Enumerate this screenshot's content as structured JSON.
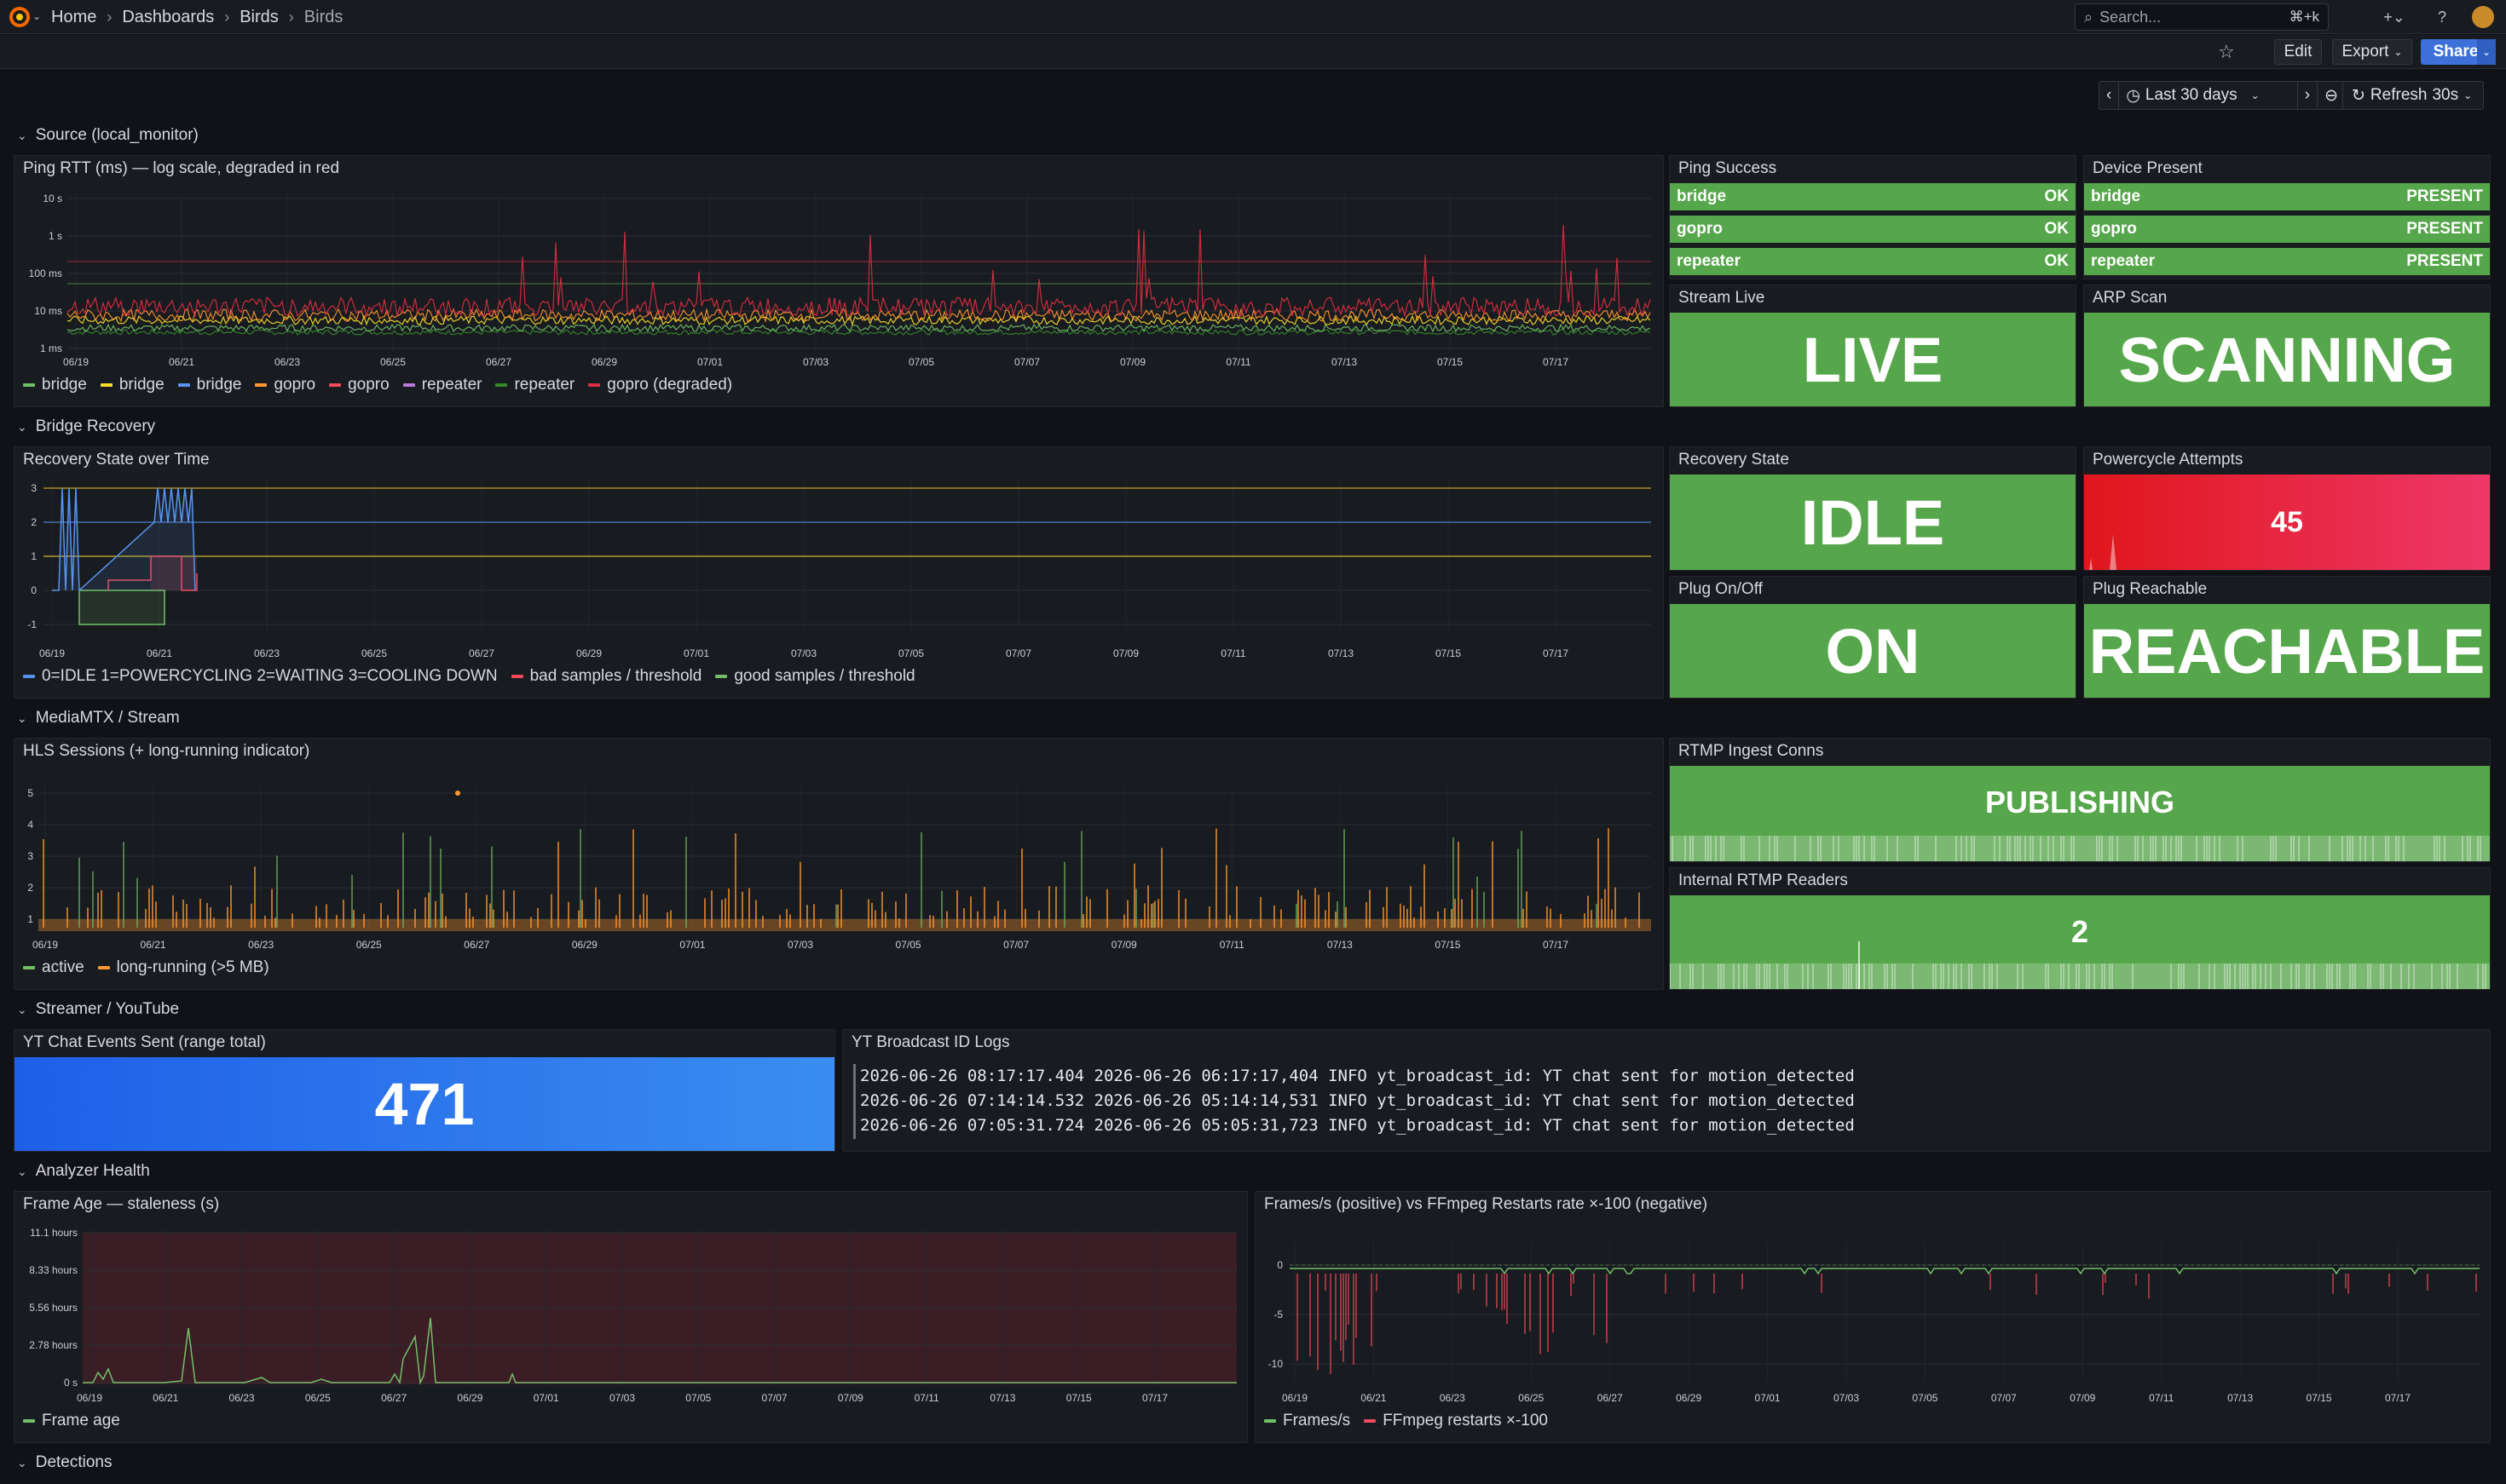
{
  "breadcrumb": {
    "home": "Home",
    "dashboards": "Dashboards",
    "folder": "Birds",
    "current": "Birds"
  },
  "search": {
    "placeholder": "Search...",
    "shortcut": "⌘+k"
  },
  "toolbar": {
    "edit": "Edit",
    "export": "Export",
    "share": "Share"
  },
  "time": {
    "range": "Last 30 days",
    "refresh": "Refresh",
    "refresh_interval": "30s"
  },
  "rows": {
    "source": "Source (local_monitor)",
    "bridge": "Bridge Recovery",
    "mediamtx": "MediaMTX / Stream",
    "streamer": "Streamer / YouTube",
    "analyzer": "Analyzer Health",
    "detections": "Detections"
  },
  "date_ticks": [
    "06/19",
    "06/21",
    "06/23",
    "06/25",
    "06/27",
    "06/29",
    "07/01",
    "07/03",
    "07/05",
    "07/07",
    "07/09",
    "07/11",
    "07/13",
    "07/15",
    "07/17"
  ],
  "panels": {
    "ping_rtt": {
      "title": "Ping RTT (ms) — log scale, degraded in red",
      "y_ticks": [
        "10 s",
        "1 s",
        "100 ms",
        "10 ms",
        "1 ms"
      ],
      "legend": [
        {
          "label": "bridge",
          "color": "#73bf69"
        },
        {
          "label": "bridge",
          "color": "#fade2a"
        },
        {
          "label": "bridge",
          "color": "#5794f2"
        },
        {
          "label": "gopro",
          "color": "#ff9830"
        },
        {
          "label": "gopro",
          "color": "#f2495c"
        },
        {
          "label": "repeater",
          "color": "#b877d9"
        },
        {
          "label": "repeater",
          "color": "#37872d"
        },
        {
          "label": "gopro (degraded)",
          "color": "#e02f44"
        }
      ]
    },
    "ping_success": {
      "title": "Ping Success",
      "rows": [
        {
          "name": "bridge",
          "value": "OK"
        },
        {
          "name": "gopro",
          "value": "OK"
        },
        {
          "name": "repeater",
          "value": "OK"
        }
      ]
    },
    "device_present": {
      "title": "Device Present",
      "rows": [
        {
          "name": "bridge",
          "value": "PRESENT"
        },
        {
          "name": "gopro",
          "value": "PRESENT"
        },
        {
          "name": "repeater",
          "value": "PRESENT"
        }
      ]
    },
    "stream_live": {
      "title": "Stream Live",
      "value": "LIVE"
    },
    "arp_scan": {
      "title": "ARP Scan",
      "value": "SCANNING"
    },
    "recovery_over_time": {
      "title": "Recovery State over Time",
      "y_ticks": [
        "3",
        "2",
        "1",
        "0",
        "-1"
      ],
      "legend": [
        {
          "label": "0=IDLE 1=POWERCYCLING 2=WAITING 3=COOLING DOWN",
          "color": "#5794f2"
        },
        {
          "label": "bad samples / threshold",
          "color": "#f2495c"
        },
        {
          "label": "good samples / threshold",
          "color": "#73bf69"
        }
      ]
    },
    "recovery_state": {
      "title": "Recovery State",
      "value": "IDLE"
    },
    "powercycle": {
      "title": "Powercycle Attempts",
      "value": "45"
    },
    "plug_onoff": {
      "title": "Plug On/Off",
      "value": "ON"
    },
    "plug_reachable": {
      "title": "Plug Reachable",
      "value": "REACHABLE"
    },
    "hls_sessions": {
      "title": "HLS Sessions (+ long-running indicator)",
      "y_ticks": [
        "5",
        "4",
        "3",
        "2",
        "1"
      ],
      "legend": [
        {
          "label": "active",
          "color": "#73bf69"
        },
        {
          "label": "long-running (>5 MB)",
          "color": "#ff9830"
        }
      ]
    },
    "rtmp_ingest": {
      "title": "RTMP Ingest Conns",
      "value": "PUBLISHING"
    },
    "rtmp_readers": {
      "title": "Internal RTMP Readers",
      "value": "2"
    },
    "yt_chat": {
      "title": "YT Chat Events Sent (range total)",
      "value": "471"
    },
    "yt_logs": {
      "title": "YT Broadcast ID Logs",
      "lines": [
        "2026-06-26 08:17:17.404 2026-06-26 06:17:17,404 INFO yt_broadcast_id: YT chat sent for motion_detected",
        "2026-06-26 07:14:14.532 2026-06-26 05:14:14,531 INFO yt_broadcast_id: YT chat sent for motion_detected",
        "2026-06-26 07:05:31.724 2026-06-26 05:05:31,723 INFO yt_broadcast_id: YT chat sent for motion_detected"
      ]
    },
    "frame_age": {
      "title": "Frame Age — staleness (s)",
      "y_ticks": [
        "11.1 hours",
        "8.33 hours",
        "5.56 hours",
        "2.78 hours",
        "0 s"
      ],
      "legend": [
        {
          "label": "Frame age",
          "color": "#73bf69"
        }
      ]
    },
    "fps": {
      "title": "Frames/s (positive) vs FFmpeg Restarts rate ×-100 (negative)",
      "y_ticks": [
        "0",
        "-5",
        "-10"
      ],
      "legend": [
        {
          "label": "Frames/s",
          "color": "#73bf69"
        },
        {
          "label": "FFmpeg restarts ×-100",
          "color": "#f2495c"
        }
      ]
    }
  }
}
